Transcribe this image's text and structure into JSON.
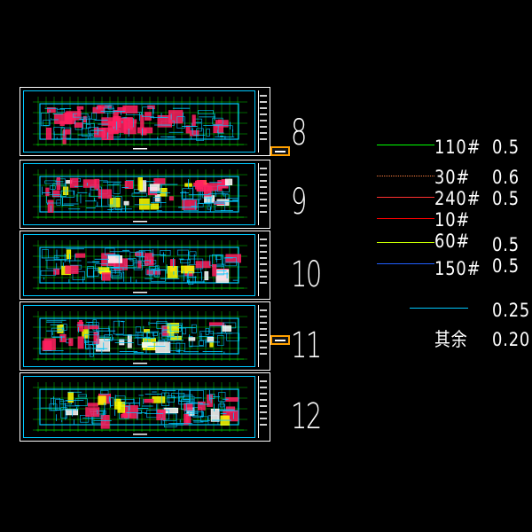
{
  "floors": [
    {
      "label": "8",
      "has_tag": true
    },
    {
      "label": "9",
      "has_tag": false
    },
    {
      "label": "10",
      "has_tag": false
    },
    {
      "label": "11",
      "has_tag": true
    },
    {
      "label": "12",
      "has_tag": false
    }
  ],
  "legend": [
    {
      "name": "110#",
      "value": "0.5",
      "color": "#00ff00"
    },
    {
      "name": "30#",
      "value": "0.6",
      "color": "#ff8040"
    },
    {
      "name": "240#",
      "value": "0.5",
      "color": "#ff3030"
    },
    {
      "name": "10#",
      "value": "",
      "color": "#ff0000"
    },
    {
      "name": "60#",
      "value": "0.5",
      "color": "#c8ff00"
    },
    {
      "name": "150#",
      "value": "0.5",
      "color": "#2060ff"
    }
  ],
  "extra": [
    {
      "name": "",
      "value": "0.25",
      "color": "#00c8ff"
    },
    {
      "name": "其余",
      "value": "0.20",
      "color": ""
    }
  ],
  "colors": {
    "background": "#000000",
    "frame": "#ffffff",
    "cyan": "#00c8ff",
    "green": "#00ff00",
    "magenta": "#ff2060",
    "tag": "#ffa000"
  }
}
